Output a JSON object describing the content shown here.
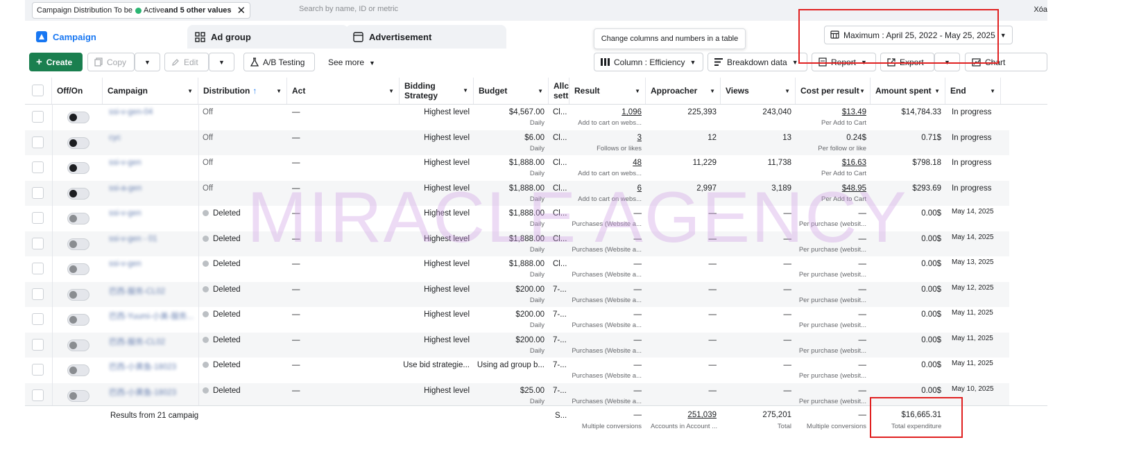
{
  "filter": {
    "chip_prefix": "Campaign Distribution To be",
    "chip_active": "Active",
    "chip_more": "and 5 other values",
    "search_placeholder": "Search by name, ID or metric",
    "clear": "Xóa"
  },
  "tabs": [
    {
      "label": "Campaign",
      "icon": "campaign-icon",
      "active": true
    },
    {
      "label": "Ad group",
      "icon": "grid-icon",
      "active": false
    },
    {
      "label": "Advertisement",
      "icon": "ad-icon",
      "active": false
    }
  ],
  "tooltip": "Change columns and numbers in a table",
  "date_range": "Maximum : April 25, 2022 - May 25, 2025",
  "toolbar": {
    "create": "Create",
    "copy": "Copy",
    "edit": "Edit",
    "ab_testing": "A/B Testing",
    "see_more": "See more",
    "column": "Column : Efficiency",
    "breakdown": "Breakdown data",
    "report": "Report",
    "export": "Export",
    "chart": "Chart"
  },
  "columns": {
    "off_on": "Off/On",
    "campaign": "Campaign",
    "distribution": "Distribution",
    "act": "Act",
    "bidding_1": "Bidding",
    "bidding_2": "Strategy",
    "budget": "Budget",
    "allo_1": "Allc",
    "allo_2": "sett",
    "result": "Result",
    "approacher": "Approacher",
    "views": "Views",
    "cost_per_result": "Cost per result",
    "amount_spent": "Amount spent",
    "end": "End"
  },
  "rows": [
    {
      "toggle": "on",
      "campaign": "ssi-v-gen-04",
      "distribution": "Off",
      "act": "—",
      "bidding": "Highest level",
      "budget": "$4,567.00",
      "budget_sub": "Daily",
      "allo": "Cl...",
      "result": "1,096",
      "result_sub": "Add to cart on webs...",
      "approacher": "225,393",
      "views": "243,040",
      "cpr": "$13.49",
      "cpr_sub": "Per Add to Cart",
      "spent": "$14,784.33",
      "end": "In progress"
    },
    {
      "toggle": "on",
      "campaign": "cyc",
      "distribution": "Off",
      "act": "—",
      "bidding": "Highest level",
      "budget": "$6.00",
      "budget_sub": "Daily",
      "allo": "Cl...",
      "result": "3",
      "result_sub": "Follows or likes",
      "approacher": "12",
      "views": "13",
      "cpr": "0.24$",
      "cpr_sub": "Per follow or like",
      "spent": "0.71$",
      "end": "In progress"
    },
    {
      "toggle": "on",
      "campaign": "ssi-v-gen",
      "distribution": "Off",
      "act": "—",
      "bidding": "Highest level",
      "budget": "$1,888.00",
      "budget_sub": "Daily",
      "allo": "Cl...",
      "result": "48",
      "result_sub": "Add to cart on webs...",
      "approacher": "11,229",
      "views": "11,738",
      "cpr": "$16.63",
      "cpr_sub": "Per Add to Cart",
      "spent": "$798.18",
      "end": "In progress"
    },
    {
      "toggle": "on",
      "campaign": "ssi-a-gen",
      "distribution": "Off",
      "act": "—",
      "bidding": "Highest level",
      "budget": "$1,888.00",
      "budget_sub": "Daily",
      "allo": "Cl...",
      "result": "6",
      "result_sub": "Add to cart on webs...",
      "approacher": "2,997",
      "views": "3,189",
      "cpr": "$48.95",
      "cpr_sub": "Per Add to Cart",
      "spent": "$293.69",
      "end": "In progress"
    },
    {
      "toggle": "deleted",
      "campaign": "ssi-v-gen",
      "distribution": "Deleted",
      "act": "—",
      "bidding": "Highest level",
      "budget": "$1,888.00",
      "budget_sub": "Daily",
      "allo": "Cl...",
      "result": "—",
      "result_sub": "Purchases (Website a...",
      "approacher": "—",
      "views": "—",
      "cpr": "—",
      "cpr_sub": "Per purchase (websit...",
      "spent": "0.00$",
      "end": "May 14, 2025"
    },
    {
      "toggle": "deleted",
      "campaign": "ssi-v-gen - 01",
      "distribution": "Deleted",
      "act": "—",
      "bidding": "Highest level",
      "budget": "$1,888.00",
      "budget_sub": "Daily",
      "allo": "Cl...",
      "result": "—",
      "result_sub": "Purchases (Website a...",
      "approacher": "—",
      "views": "—",
      "cpr": "—",
      "cpr_sub": "Per purchase (websit...",
      "spent": "0.00$",
      "end": "May 14, 2025"
    },
    {
      "toggle": "deleted",
      "campaign": "ssi-v-gen",
      "distribution": "Deleted",
      "act": "—",
      "bidding": "Highest level",
      "budget": "$1,888.00",
      "budget_sub": "Daily",
      "allo": "Cl...",
      "result": "—",
      "result_sub": "Purchases (Website a...",
      "approacher": "—",
      "views": "—",
      "cpr": "—",
      "cpr_sub": "Per purchase (websit...",
      "spent": "0.00$",
      "end": "May 13, 2025"
    },
    {
      "toggle": "deleted",
      "campaign": "巴西-服务-CL02",
      "distribution": "Deleted",
      "act": "—",
      "bidding": "Highest level",
      "budget": "$200.00",
      "budget_sub": "Daily",
      "allo": "7-...",
      "result": "—",
      "result_sub": "Purchases (Website a...",
      "approacher": "—",
      "views": "—",
      "cpr": "—",
      "cpr_sub": "Per purchase (websit...",
      "spent": "0.00$",
      "end": "May 12, 2025"
    },
    {
      "toggle": "deleted",
      "campaign": "巴西-Yuumi-小美-服务...",
      "distribution": "Deleted",
      "act": "—",
      "bidding": "Highest level",
      "budget": "$200.00",
      "budget_sub": "Daily",
      "allo": "7-...",
      "result": "—",
      "result_sub": "Purchases (Website a...",
      "approacher": "—",
      "views": "—",
      "cpr": "—",
      "cpr_sub": "Per purchase (websit...",
      "spent": "0.00$",
      "end": "May 11, 2025"
    },
    {
      "toggle": "deleted",
      "campaign": "巴西-服务-CL02",
      "distribution": "Deleted",
      "act": "—",
      "bidding": "Highest level",
      "budget": "$200.00",
      "budget_sub": "Daily",
      "allo": "7-...",
      "result": "—",
      "result_sub": "Purchases (Website a...",
      "approacher": "—",
      "views": "—",
      "cpr": "—",
      "cpr_sub": "Per purchase (websit...",
      "spent": "0.00$",
      "end": "May 11, 2025"
    },
    {
      "toggle": "deleted",
      "campaign": "巴西-小黄鱼-18023",
      "distribution": "Deleted",
      "act": "—",
      "bidding": "Use bid strategie...",
      "budget": "Using ad group b...",
      "budget_sub": "",
      "allo": "7-...",
      "result": "—",
      "result_sub": "Purchases (Website a...",
      "approacher": "—",
      "views": "—",
      "cpr": "—",
      "cpr_sub": "Per purchase (websit...",
      "spent": "0.00$",
      "end": "May 11, 2025"
    },
    {
      "toggle": "deleted",
      "campaign": "巴西-小黄鱼-18023",
      "distribution": "Deleted",
      "act": "—",
      "bidding": "Highest level",
      "budget": "$25.00",
      "budget_sub": "Daily",
      "allo": "7-...",
      "result": "—",
      "result_sub": "Purchases (Website a...",
      "approacher": "—",
      "views": "—",
      "cpr": "—",
      "cpr_sub": "Per purchase (websit...",
      "spent": "0.00$",
      "end": "May 10, 2025"
    }
  ],
  "footer": {
    "label": "Results from 21 campaig",
    "allo": "S...",
    "result": "—",
    "result_sub": "Multiple conversions",
    "approacher": "251,039",
    "approacher_sub": "Accounts in Account ...",
    "views": "275,201",
    "views_sub": "Total",
    "cpr": "—",
    "cpr_sub": "Multiple conversions",
    "spent": "$16,665.31",
    "spent_sub": "Total expenditure"
  },
  "watermark": "MIRACLE AGENCY",
  "colors": {
    "accent": "#1877f2",
    "create": "#1a7f4f",
    "highlight": "#e02020",
    "watermark": "#ce9be4"
  }
}
